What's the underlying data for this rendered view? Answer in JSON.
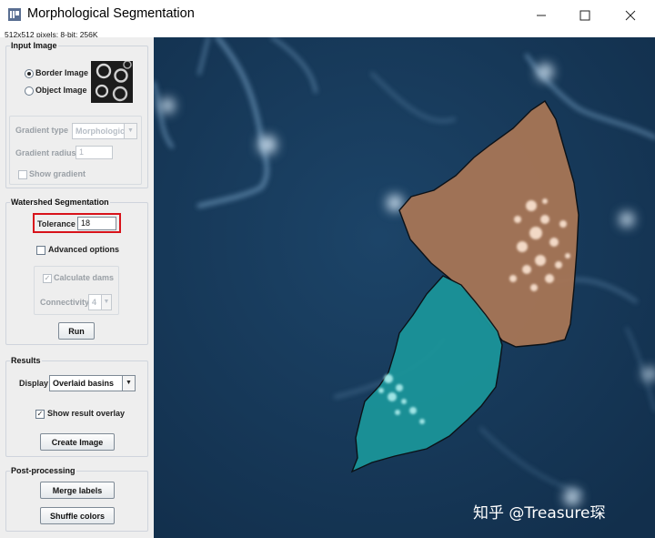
{
  "window": {
    "title": "Morphological Segmentation",
    "info": "512x512 pixels; 8-bit; 256K"
  },
  "input_image": {
    "title": "Input Image",
    "border_image_label": "Border Image",
    "object_image_label": "Object Image",
    "selected": "Border Image",
    "gradient_type_label": "Gradient type",
    "gradient_type_value": "Morphological",
    "gradient_radius_label": "Gradient radius",
    "gradient_radius_value": "1",
    "show_gradient_label": "Show gradient",
    "show_gradient_checked": false
  },
  "watershed": {
    "title": "Watershed Segmentation",
    "tolerance_label": "Tolerance",
    "tolerance_value": "18",
    "advanced_label": "Advanced options",
    "advanced_checked": false,
    "calculate_dams_label": "Calculate dams",
    "calculate_dams_checked": true,
    "connectivity_label": "Connectivity",
    "connectivity_value": "4",
    "run_label": "Run",
    "highlight_color": "#d8131b"
  },
  "results": {
    "title": "Results",
    "display_label": "Display",
    "display_value": "Overlaid basins",
    "show_overlay_label": "Show result overlay",
    "show_overlay_checked": true,
    "create_image_label": "Create Image"
  },
  "post_processing": {
    "title": "Post-processing",
    "merge_labels_label": "Merge labels",
    "shuffle_colors_label": "Shuffle colors"
  },
  "image_view": {
    "background_color": "#173b5c",
    "basin_colors": [
      "#a77556",
      "#1b9499"
    ],
    "watermark": "知乎 @Treasure琛"
  }
}
